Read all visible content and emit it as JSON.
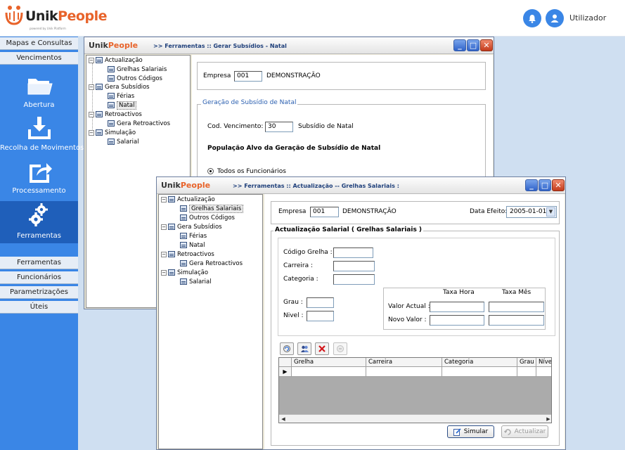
{
  "app": {
    "brand_first": "Unik",
    "brand_second": "People",
    "brand_tagline": "powered by Unik Platform",
    "user_label": "Utilizador"
  },
  "sidebar": {
    "top_tabs": [
      "Mapas e Consultas",
      "Vencimentos"
    ],
    "big_items": [
      {
        "label": "Abertura",
        "icon": "folder-icon"
      },
      {
        "label": "Recolha de Movimentos",
        "icon": "download-icon"
      },
      {
        "label": "Processamento",
        "icon": "share-icon"
      },
      {
        "label": "Ferramentas",
        "icon": "gears-icon",
        "active": true
      }
    ],
    "bottom_tabs": [
      "Ferramentas",
      "Funcionários",
      "Parametrizações",
      "Úteis"
    ]
  },
  "win_back": {
    "brand_first": "Unik",
    "brand_second": "People",
    "title": ">> Ferramentas  :: Gerar Subsídios - Natal",
    "tree": {
      "g1": "Actualização",
      "g1_items": [
        "Grelhas Salariais",
        "Outros Códigos"
      ],
      "g2": "Gera Subsídios",
      "g2_items": [
        "Férias",
        "Natal"
      ],
      "g3": "Retroactivos",
      "g3_items": [
        "Gera Retroactivos"
      ],
      "g4": "Simulação",
      "g4_items": [
        "Salarial"
      ]
    },
    "empresa_label": "Empresa",
    "empresa_code": "001",
    "empresa_name": "DEMONSTRAÇÃO",
    "group_title": "Geração de Subsídio de Natal",
    "cod_label": "Cod. Vencimento:",
    "cod_value": "30",
    "cod_desc": "Subsídio de Natal",
    "population_title": "População Alvo da Geração de Subsídio de Natal",
    "radio_all": "Todos os Funcionários"
  },
  "win_front": {
    "brand_first": "Unik",
    "brand_second": "People",
    "title": ">> Ferramentas  :: Actualização  -- Grelhas Salariais  :",
    "tree": {
      "g1": "Actualização",
      "g1_items": [
        "Grelhas Salariais",
        "Outros Códigos"
      ],
      "g2": "Gera Subsídios",
      "g2_items": [
        "Férias",
        "Natal"
      ],
      "g3": "Retroactivos",
      "g3_items": [
        "Gera Retroactivos"
      ],
      "g4": "Simulação",
      "g4_items": [
        "Salarial"
      ]
    },
    "empresa_label": "Empresa",
    "empresa_code": "001",
    "empresa_name": "DEMONSTRAÇÃO",
    "data_efeito_label": "Data Efeito:",
    "data_efeito_value": "2005-01-01",
    "group_title": "Actualização Salarial  ( Grelhas Salariais )",
    "codigo_grelha_label": "Código Grelha :",
    "carreira_label": "Carreira :",
    "categoria_label": "Categoria :",
    "grau_label": "Grau :",
    "nivel_label": "Nivel :",
    "taxa_hora_label": "Taxa Hora",
    "taxa_mes_label": "Taxa Mês",
    "valor_actual_label": "Valor Actual :",
    "novo_valor_label": "Novo Valor :",
    "grid_columns": [
      "Grelha",
      "Carreira",
      "Categoria",
      "Grau",
      "Nível"
    ],
    "simular_label": "Simular",
    "actualizar_label": "Actualizar"
  },
  "colors": {
    "accent": "#3a86e6",
    "sidebar_active": "#1f5fba",
    "brand_orange": "#e8632a"
  }
}
